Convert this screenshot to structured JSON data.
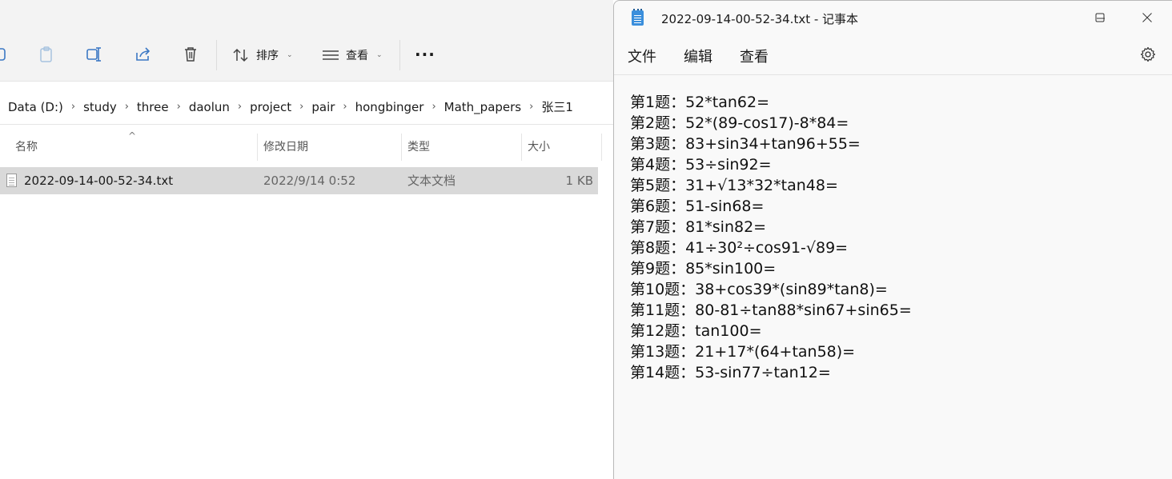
{
  "explorer": {
    "toolbar": {
      "sort_label": "排序",
      "view_label": "查看",
      "more_label": "···"
    },
    "breadcrumb": [
      "Data (D:)",
      "study",
      "three",
      "daolun",
      "project",
      "pair",
      "hongbinger",
      "Math_papers",
      "张三1"
    ],
    "columns": {
      "name": "名称",
      "modified": "修改日期",
      "type": "类型",
      "size": "大小"
    },
    "files": [
      {
        "name": "2022-09-14-00-52-34.txt",
        "modified": "2022/9/14 0:52",
        "type": "文本文档",
        "size": "1 KB"
      }
    ]
  },
  "notepad": {
    "title": "2022-09-14-00-52-34.txt - 记事本",
    "menu": [
      "文件",
      "编辑",
      "查看"
    ],
    "lines": [
      "第1题：52*tan62=",
      "第2题：52*(89-cos17)-8*84=",
      "第3题：83+sin34+tan96+55=",
      "第4题：53÷sin92=",
      "第5题：31+√13*32*tan48=",
      "第6题：51-sin68=",
      "第7题：81*sin82=",
      "第8题：41÷30²÷cos91-√89=",
      "第9题：85*sin100=",
      "第10题：38+cos39*(sin89*tan8)=",
      "第11题：80-81÷tan88*sin67+sin65=",
      "第12题：tan100=",
      "第13题：21+17*(64+tan58)=",
      "第14题：53-sin77÷tan12="
    ]
  },
  "colors": {
    "selection": "#d9d9d9",
    "toolbar_bg": "#f3f3f3",
    "notepad_bg": "#f9f9f9",
    "notepad_icon": "#3b8fdc"
  }
}
